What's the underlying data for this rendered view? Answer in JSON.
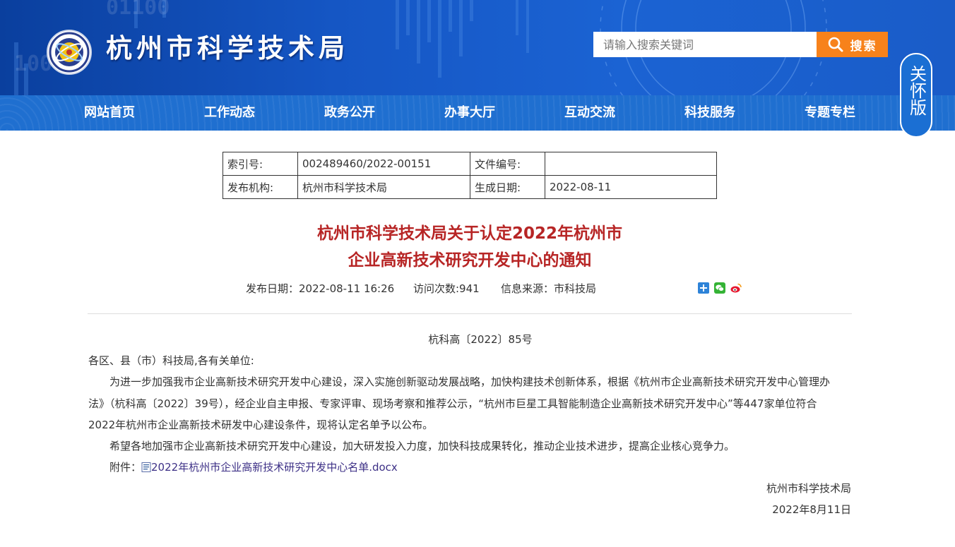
{
  "header": {
    "site_title": "杭州市科学技术局",
    "search_placeholder": "请输入搜索关键词",
    "search_button": "搜索",
    "care_mode": "关怀版"
  },
  "nav": {
    "items": [
      "网站首页",
      "工作动态",
      "政务公开",
      "办事大厅",
      "互动交流",
      "科技服务",
      "专题专栏"
    ]
  },
  "info": {
    "index_label": "索引号:",
    "index_value": "002489460/2022-00151",
    "docno_label": "文件编号:",
    "docno_value": "",
    "org_label": "发布机构:",
    "org_value": "杭州市科学技术局",
    "date_label": "生成日期:",
    "date_value": "2022-08-11"
  },
  "article": {
    "title_line1": "杭州市科学技术局关于认定2022年杭州市",
    "title_line2": "企业高新技术研究开发中心的通知",
    "publish_date": "发布日期：2022-08-11 16:26",
    "visits": "访问次数:941",
    "source": "信息来源：市科技局",
    "doc_number": "杭科高〔2022〕85号",
    "salutation": "各区、县（市）科技局,各有关单位:",
    "para1_line1": "为进一步加强我市企业高新技术研究开发中心建设，深入实施创新驱动发展战略，加快构建技术创新体系，根据《杭州市企业高新技术研究开发中心管理办",
    "para1_line2": "法》（杭科高〔2022〕39号），经企业自主申报、专家评审、现场考察和推荐公示，“杭州市巨星工具智能制造企业高新技术研究开发中心”等447家单位符合",
    "para1_line3": "2022年杭州市企业高新技术研发中心建设条件，现将认定名单予以公布。",
    "para2": "希望各地加强市企业高新技术研究开发中心建设，加大研发投入力度，加快科技成果转化，推动企业技术进步，提高企业核心竞争力。",
    "attachment_label": "附件：",
    "attachment_name": "2022年杭州市企业高新技术研究开发中心名单.docx",
    "signature": "杭州市科学技术局",
    "sign_date": "2022年8月11日"
  },
  "colors": {
    "header_blue": "#1556c4",
    "nav_blue": "#1f6fd0",
    "search_orange": "#f7821b",
    "title_red": "#b72525",
    "link_purple": "#3d3086"
  },
  "icons": [
    "site-logo-icon",
    "search-icon",
    "share-plus-icon",
    "wechat-icon",
    "weibo-icon",
    "docx-file-icon"
  ]
}
